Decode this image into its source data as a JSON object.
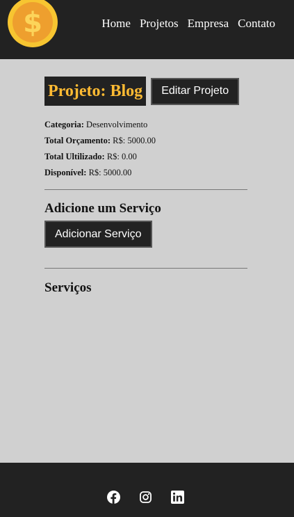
{
  "nav": {
    "logo": "dollar-coin-logo",
    "links": [
      "Home",
      "Projetos",
      "Empresa",
      "Contato"
    ]
  },
  "project": {
    "title": "Projeto: Blog",
    "edit_label": "Editar Projeto",
    "details": [
      {
        "label": "Categoria:",
        "value": "Desenvolvimento"
      },
      {
        "label": "Total Orçamento:",
        "value": "R$: 5000.00"
      },
      {
        "label": "Total Ultilizado:",
        "value": "R$: 0.00"
      },
      {
        "label": "Disponível:",
        "value": "R$: 5000.00"
      }
    ]
  },
  "add_service": {
    "heading": "Adicione um Serviço",
    "button_label": "Adicionar Serviço"
  },
  "services": {
    "heading": "Serviços"
  },
  "footer": {
    "icons": [
      "facebook-icon",
      "instagram-icon",
      "linkedin-icon"
    ]
  },
  "colors": {
    "dark": "#222222",
    "background": "#d0d0d0",
    "accent": "#ffbb33"
  }
}
